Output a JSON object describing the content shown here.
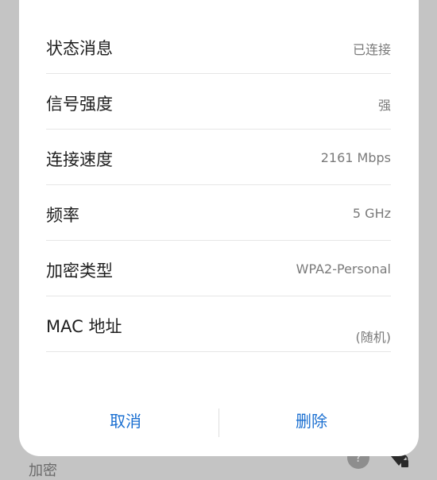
{
  "dialog": {
    "rows": [
      {
        "label": "状态消息",
        "value": "已连接"
      },
      {
        "label": "信号强度",
        "value": "强"
      },
      {
        "label": "连接速度",
        "value": "2161 Mbps"
      },
      {
        "label": "频率",
        "value": "5 GHz"
      },
      {
        "label": "加密类型",
        "value": "WPA2-Personal"
      },
      {
        "label": "MAC 地址",
        "value": "(随机)"
      }
    ],
    "cancel_label": "取消",
    "delete_label": "删除"
  },
  "background": {
    "encryption_label": "加密",
    "help_icon": "help-icon",
    "wifi_lock_icon": "wifi-lock-icon"
  },
  "colors": {
    "accent": "#1a6fd1",
    "overlay": "#c4c4c4"
  }
}
